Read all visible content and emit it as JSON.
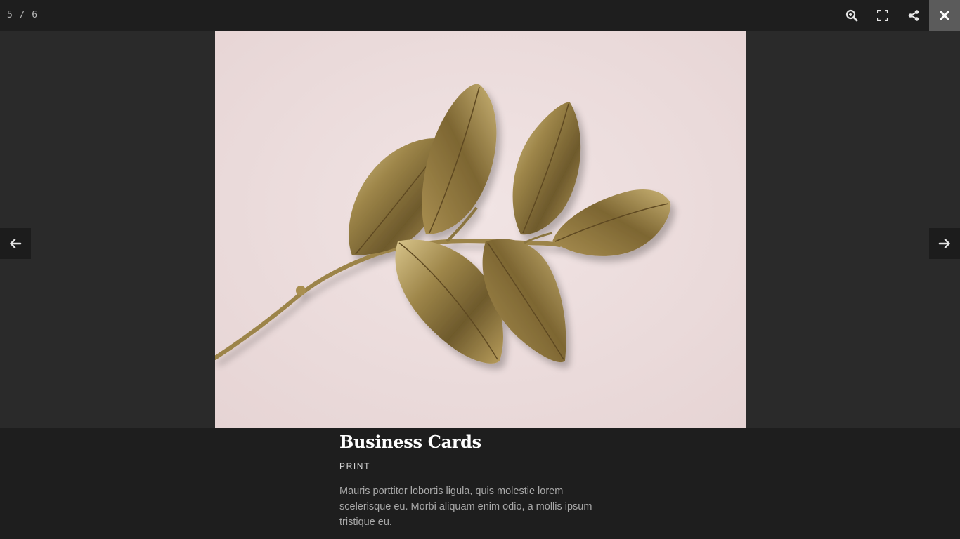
{
  "lightbox": {
    "counter": "5 / 6",
    "toolbar": {
      "zoom_icon": "zoom-in-icon",
      "fullscreen_icon": "fullscreen-icon",
      "share_icon": "share-icon",
      "close_icon": "close-icon"
    },
    "nav": {
      "prev_icon": "arrow-left-icon",
      "next_icon": "arrow-right-icon"
    },
    "image": {
      "subject": "gold-painted-leaf-branch-on-pink-background"
    },
    "caption": {
      "title": "Business Cards",
      "category": "PRINT",
      "description": "Mauris porttitor lobortis ligula, quis molestie lorem scelerisque eu. Morbi aliquam enim odio, a mollis ipsum tristique eu."
    }
  },
  "colors": {
    "background": "#1e1e1e",
    "stage": "#2a2a2a",
    "close_active": "#5b5b5b",
    "photo_background": "#ecdcdc",
    "gold": "#8a7440"
  }
}
